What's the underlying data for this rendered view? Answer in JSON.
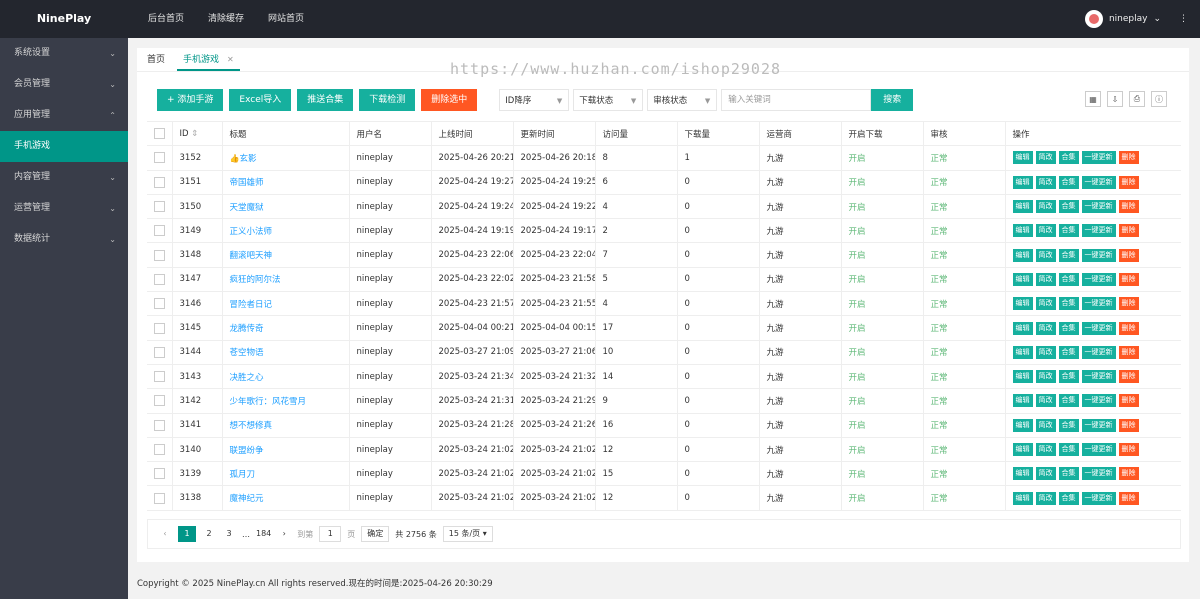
{
  "app": {
    "title": "NinePlay"
  },
  "sidebar": {
    "items": [
      {
        "label": "系统设置",
        "arrow": "⌄"
      },
      {
        "label": "会员管理",
        "arrow": "⌄"
      },
      {
        "label": "应用管理",
        "arrow": "⌃"
      },
      {
        "label": "手机游戏",
        "arrow": ""
      },
      {
        "label": "内容管理",
        "arrow": "⌄"
      },
      {
        "label": "运营管理",
        "arrow": "⌄"
      },
      {
        "label": "数据统计",
        "arrow": "⌄"
      }
    ]
  },
  "topnav": {
    "items": [
      "后台首页",
      "清除缓存",
      "网站首页"
    ],
    "user": "nineplay",
    "more": "⋮"
  },
  "tabs": {
    "home": "首页",
    "current": "手机游戏",
    "close": "✕"
  },
  "watermark": "https://www.huzhan.com/ishop29028",
  "toolbar": {
    "add": "+ 添加手游",
    "excel": "Excel导入",
    "push": "推送合集",
    "check": "下载检测",
    "delete_selected": "删除选中",
    "sort": "ID降序",
    "download_status": "下载状态",
    "review_status": "审核状态",
    "keyword_placeholder": "输入关键词",
    "search": "搜索"
  },
  "table": {
    "headers": [
      "ID",
      "标题",
      "用户名",
      "上线时间",
      "更新时间",
      "访问量",
      "下载量",
      "运营商",
      "开启下载",
      "审核",
      "操作"
    ],
    "sort_icon": "⇕",
    "actions": [
      "编辑",
      "简改",
      "合集",
      "一键更新",
      "删除"
    ],
    "rows": [
      {
        "id": "3152",
        "title": "玄影",
        "hot": true,
        "user": "nineplay",
        "online": "2025-04-26 20:21:",
        "updated": "2025-04-26 20:18:",
        "visits": "8",
        "downloads": "1",
        "vendor": "九游",
        "dl": "开启",
        "review": "正常"
      },
      {
        "id": "3151",
        "title": "帝国雄师",
        "hot": false,
        "user": "nineplay",
        "online": "2025-04-24 19:27:",
        "updated": "2025-04-24 19:25:",
        "visits": "6",
        "downloads": "0",
        "vendor": "九游",
        "dl": "开启",
        "review": "正常"
      },
      {
        "id": "3150",
        "title": "天堂魔狱",
        "hot": false,
        "user": "nineplay",
        "online": "2025-04-24 19:24:",
        "updated": "2025-04-24 19:22:",
        "visits": "4",
        "downloads": "0",
        "vendor": "九游",
        "dl": "开启",
        "review": "正常"
      },
      {
        "id": "3149",
        "title": "正义小法师",
        "hot": false,
        "user": "nineplay",
        "online": "2025-04-24 19:19:",
        "updated": "2025-04-24 19:17:",
        "visits": "2",
        "downloads": "0",
        "vendor": "九游",
        "dl": "开启",
        "review": "正常"
      },
      {
        "id": "3148",
        "title": "翻滚吧天神",
        "hot": false,
        "user": "nineplay",
        "online": "2025-04-23 22:06:",
        "updated": "2025-04-23 22:04:",
        "visits": "7",
        "downloads": "0",
        "vendor": "九游",
        "dl": "开启",
        "review": "正常"
      },
      {
        "id": "3147",
        "title": "疯狂的阿尔法",
        "hot": false,
        "user": "nineplay",
        "online": "2025-04-23 22:02:",
        "updated": "2025-04-23 21:58:",
        "visits": "5",
        "downloads": "0",
        "vendor": "九游",
        "dl": "开启",
        "review": "正常"
      },
      {
        "id": "3146",
        "title": "冒险者日记",
        "hot": false,
        "user": "nineplay",
        "online": "2025-04-23 21:57:",
        "updated": "2025-04-23 21:55:",
        "visits": "4",
        "downloads": "0",
        "vendor": "九游",
        "dl": "开启",
        "review": "正常"
      },
      {
        "id": "3145",
        "title": "龙腾传奇",
        "hot": false,
        "user": "nineplay",
        "online": "2025-04-04 00:21:",
        "updated": "2025-04-04 00:15:",
        "visits": "17",
        "downloads": "0",
        "vendor": "九游",
        "dl": "开启",
        "review": "正常"
      },
      {
        "id": "3144",
        "title": "苍空物语",
        "hot": false,
        "user": "nineplay",
        "online": "2025-03-27 21:09:",
        "updated": "2025-03-27 21:06:",
        "visits": "10",
        "downloads": "0",
        "vendor": "九游",
        "dl": "开启",
        "review": "正常"
      },
      {
        "id": "3143",
        "title": "决胜之心",
        "hot": false,
        "user": "nineplay",
        "online": "2025-03-24 21:34:",
        "updated": "2025-03-24 21:32:",
        "visits": "14",
        "downloads": "0",
        "vendor": "九游",
        "dl": "开启",
        "review": "正常"
      },
      {
        "id": "3142",
        "title": "少年歌行：风花雪月",
        "hot": false,
        "user": "nineplay",
        "online": "2025-03-24 21:31:",
        "updated": "2025-03-24 21:29:",
        "visits": "9",
        "downloads": "0",
        "vendor": "九游",
        "dl": "开启",
        "review": "正常"
      },
      {
        "id": "3141",
        "title": "想不想修真",
        "hot": false,
        "user": "nineplay",
        "online": "2025-03-24 21:28:",
        "updated": "2025-03-24 21:26:",
        "visits": "16",
        "downloads": "0",
        "vendor": "九游",
        "dl": "开启",
        "review": "正常"
      },
      {
        "id": "3140",
        "title": "联盟纷争",
        "hot": false,
        "user": "nineplay",
        "online": "2025-03-24 21:02:",
        "updated": "2025-03-24 21:02:",
        "visits": "12",
        "downloads": "0",
        "vendor": "九游",
        "dl": "开启",
        "review": "正常"
      },
      {
        "id": "3139",
        "title": "孤月刀",
        "hot": false,
        "user": "nineplay",
        "online": "2025-03-24 21:02:",
        "updated": "2025-03-24 21:02:",
        "visits": "15",
        "downloads": "0",
        "vendor": "九游",
        "dl": "开启",
        "review": "正常"
      },
      {
        "id": "3138",
        "title": "魔神纪元",
        "hot": false,
        "user": "nineplay",
        "online": "2025-03-24 21:02:",
        "updated": "2025-03-24 21:02:",
        "visits": "12",
        "downloads": "0",
        "vendor": "九游",
        "dl": "开启",
        "review": "正常"
      }
    ]
  },
  "pager": {
    "prev": "‹",
    "pages": [
      "1",
      "2",
      "3"
    ],
    "ellipsis": "…",
    "last": "184",
    "next": "›",
    "goto_label": "到第",
    "goto_value": "1",
    "page_unit": "页",
    "confirm": "确定",
    "total": "共 2756 条",
    "per_page": "15 条/页"
  },
  "footer": "Copyright © 2025 NinePlay.cn All rights reserved.现在的时间是:2025-04-26 20:30:29",
  "colors": {
    "accent": "#009688",
    "danger": "#ff5722",
    "sidebar": "#393d49",
    "link": "#1e9fff"
  }
}
